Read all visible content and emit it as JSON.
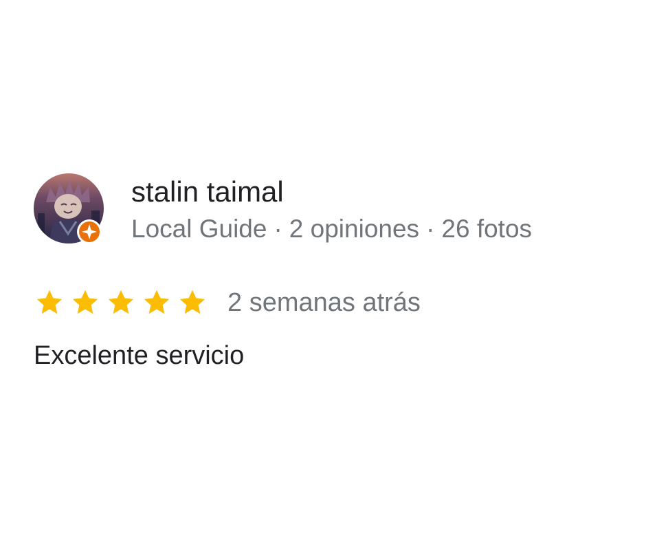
{
  "review": {
    "author": {
      "name": "stalin taimal",
      "level": "Local Guide",
      "reviews_count": "2 opiniones",
      "photos_count": "26 fotos",
      "separator": "·",
      "avatar_icon": "profile-avatar-illustration",
      "badge_icon": "local-guide-badge-icon"
    },
    "rating": 5,
    "rating_max": 5,
    "date": "2 semanas atrás",
    "text": "Excelente servicio",
    "colors": {
      "star": "#fbbc04",
      "badge": "#e8710a",
      "name_text": "#202124",
      "meta_text": "#70757a"
    }
  }
}
